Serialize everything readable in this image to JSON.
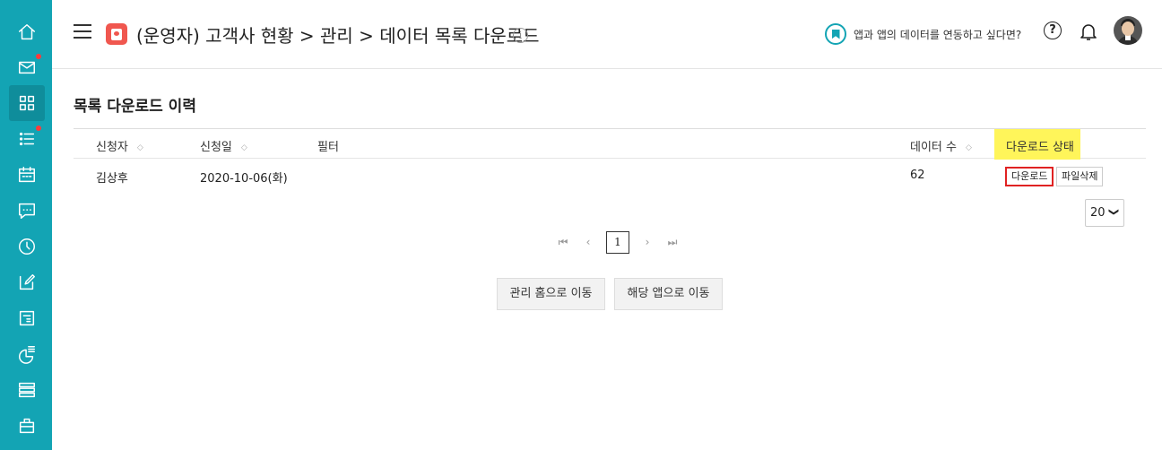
{
  "sidebar": {
    "items": [
      {
        "icon": "home-icon"
      },
      {
        "icon": "mail-icon",
        "badge": true
      },
      {
        "icon": "grid-icon",
        "active": true
      },
      {
        "icon": "list-icon",
        "badge": true
      },
      {
        "icon": "calendar-icon"
      },
      {
        "icon": "chat-icon"
      },
      {
        "icon": "clock-icon"
      },
      {
        "icon": "edit-icon"
      },
      {
        "icon": "document-icon"
      },
      {
        "icon": "chart-icon"
      },
      {
        "icon": "stack-icon"
      },
      {
        "icon": "briefcase-icon"
      }
    ],
    "color": "#13a4b4"
  },
  "header": {
    "title": "(운영자) 고객사 현황 > 관리 > 데이터 목록 다운로드",
    "info": "i",
    "promo_text": "앱과 앱의 데이터를 연동하고 싶다면?",
    "help": "?"
  },
  "main": {
    "section_title": "목록 다운로드 이력",
    "columns": {
      "requester": "신청자",
      "date": "신청일",
      "filter": "필터",
      "count": "데이터 수",
      "status": "다운로드 상태"
    },
    "rows": [
      {
        "requester": "김상후",
        "date": "2020-10-06(화)",
        "filter": "",
        "count": "62",
        "download": "다운로드",
        "delete": "파일삭제"
      }
    ],
    "page_size": "20",
    "pagination": {
      "current": "1"
    },
    "buttons": {
      "home": "관리 홈으로 이동",
      "app": "해당 앱으로 이동"
    }
  },
  "colors": {
    "accent": "#13a4b4",
    "highlight": "#fff55a",
    "alert": "#e02222"
  }
}
